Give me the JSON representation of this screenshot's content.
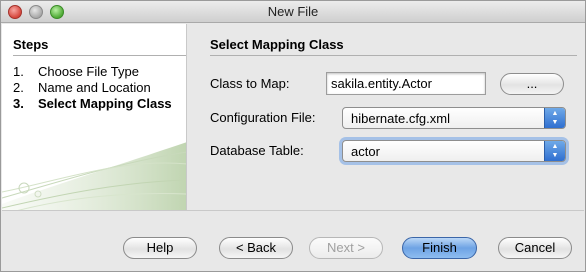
{
  "window": {
    "title": "New File"
  },
  "steps": {
    "heading": "Steps",
    "items": [
      {
        "num": "1.",
        "label": "Choose File Type"
      },
      {
        "num": "2.",
        "label": "Name and Location"
      },
      {
        "num": "3.",
        "label": "Select Mapping Class"
      }
    ]
  },
  "panel": {
    "heading": "Select Mapping Class",
    "class_label": "Class to Map:",
    "class_value": "sakila.entity.Actor",
    "browse_label": "...",
    "config_label": "Configuration File:",
    "config_value": "hibernate.cfg.xml",
    "table_label": "Database Table:",
    "table_value": "actor"
  },
  "buttons": {
    "help": "Help",
    "back": "< Back",
    "next": "Next >",
    "finish": "Finish",
    "cancel": "Cancel"
  },
  "colors": {
    "accent": "#3b7be0",
    "window_bg": "#e8e8e8"
  }
}
